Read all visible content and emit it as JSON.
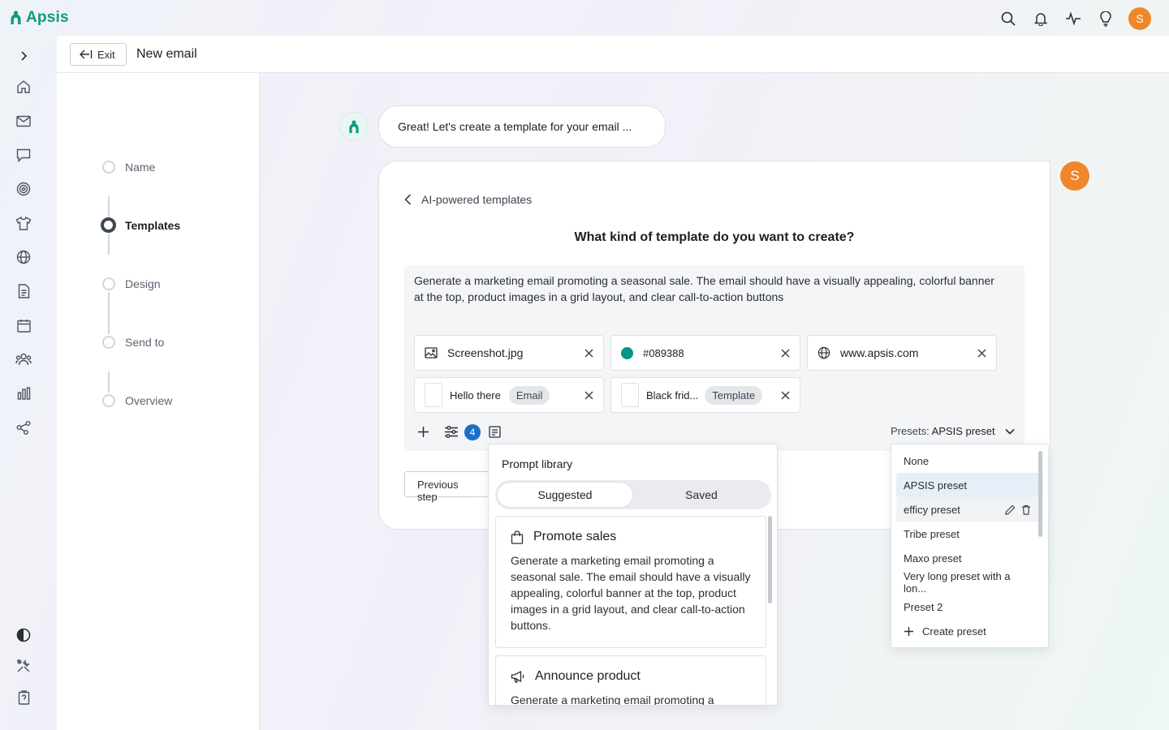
{
  "app": {
    "name": "Apsis",
    "user_initial": "S"
  },
  "header": {
    "exit_label": "Exit",
    "title": "New email"
  },
  "steps": [
    {
      "label": "Name",
      "active": false
    },
    {
      "label": "Templates",
      "active": true
    },
    {
      "label": "Design",
      "active": false
    },
    {
      "label": "Send to",
      "active": false
    },
    {
      "label": "Overview",
      "active": false
    }
  ],
  "chat": {
    "bot_message": "Great! Let's create a template for your email ...",
    "user_initial": "S"
  },
  "panel": {
    "back_label": "AI-powered templates",
    "question": "What kind of template do you want to create?",
    "prompt": "Generate a marketing email promoting a seasonal sale. The email should have a visually appealing, colorful banner at the top, product images in a grid layout, and clear call-to-action buttons",
    "chips": {
      "screenshot": "Screenshot.jpg",
      "color": "#089388",
      "url": "www.apsis.com",
      "email_ref": "Hello there",
      "email_tag": "Email",
      "template_ref": "Black frid...",
      "template_tag": "Template"
    },
    "settings_count": "4",
    "presets_label": "Presets:",
    "presets_value": "APSIS preset",
    "previous_step": "Previous step"
  },
  "library": {
    "title": "Prompt library",
    "tab_suggested": "Suggested",
    "tab_saved": "Saved",
    "cards": [
      {
        "title": "Promote sales",
        "text": "Generate a marketing email promoting a seasonal sale. The email should have a visually appealing, colorful banner at the top, product images in a grid layout, and clear call-to-action buttons."
      },
      {
        "title": "Announce product",
        "text": "Generate a marketing email promoting a"
      }
    ]
  },
  "preset_menu": {
    "items": [
      "None",
      "APSIS preset",
      "efficy preset",
      "Tribe preset",
      "Maxo preset",
      "Very long preset with a lon...",
      "Preset 2"
    ],
    "create_label": "Create preset"
  },
  "colors": {
    "brand": "#0e9b7d",
    "accent": "#f0862a",
    "badge": "#1c6fc7",
    "swatch": "#089388"
  }
}
